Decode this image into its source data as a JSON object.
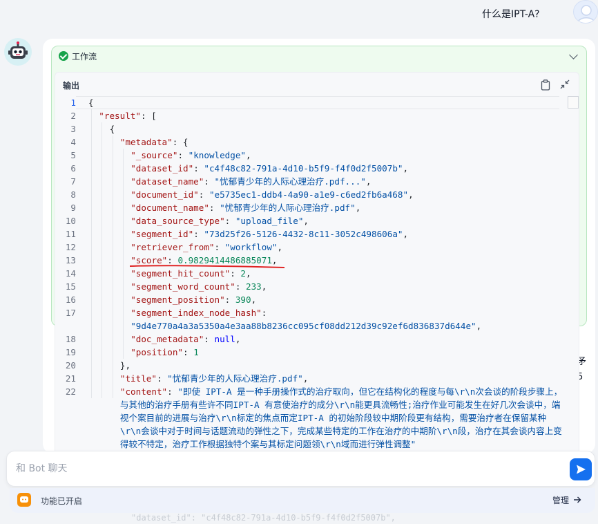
{
  "chat": {
    "user_message": "什么是IPT-A?",
    "input_placeholder": "和 Bot 聊天"
  },
  "workflow": {
    "title": "工作流",
    "status": "success"
  },
  "output": {
    "title": "输出",
    "lines": [
      {
        "n": "1",
        "indent": 0,
        "parts": [
          [
            "p",
            "{"
          ]
        ]
      },
      {
        "n": "2",
        "indent": 1,
        "parts": [
          [
            "k",
            "\"result\""
          ],
          [
            "p",
            ": ["
          ]
        ]
      },
      {
        "n": "3",
        "indent": 2,
        "parts": [
          [
            "p",
            "{"
          ]
        ]
      },
      {
        "n": "4",
        "indent": 3,
        "parts": [
          [
            "k",
            "\"metadata\""
          ],
          [
            "p",
            ": {"
          ]
        ]
      },
      {
        "n": "5",
        "indent": 4,
        "parts": [
          [
            "k",
            "\"_source\""
          ],
          [
            "p",
            ": "
          ],
          [
            "s",
            "\"knowledge\""
          ],
          [
            "p",
            ","
          ]
        ]
      },
      {
        "n": "6",
        "indent": 4,
        "parts": [
          [
            "k",
            "\"dataset_id\""
          ],
          [
            "p",
            ": "
          ],
          [
            "s",
            "\"c4f48c82-791a-4d10-b5f9-f4f0d2f5007b\""
          ],
          [
            "p",
            ","
          ]
        ]
      },
      {
        "n": "7",
        "indent": 4,
        "parts": [
          [
            "k",
            "\"dataset_name\""
          ],
          [
            "p",
            ": "
          ],
          [
            "s",
            "\"忧郁青少年的人际心理治疗.pdf...\""
          ],
          [
            "p",
            ","
          ]
        ]
      },
      {
        "n": "8",
        "indent": 4,
        "parts": [
          [
            "k",
            "\"document_id\""
          ],
          [
            "p",
            ": "
          ],
          [
            "s",
            "\"e5735ec1-ddb4-4a90-a1e9-c6ed2fb6a468\""
          ],
          [
            "p",
            ","
          ]
        ]
      },
      {
        "n": "9",
        "indent": 4,
        "parts": [
          [
            "k",
            "\"document_name\""
          ],
          [
            "p",
            ": "
          ],
          [
            "s",
            "\"忧郁青少年的人际心理治疗.pdf\""
          ],
          [
            "p",
            ","
          ]
        ]
      },
      {
        "n": "10",
        "indent": 4,
        "parts": [
          [
            "k",
            "\"data_source_type\""
          ],
          [
            "p",
            ": "
          ],
          [
            "s",
            "\"upload_file\""
          ],
          [
            "p",
            ","
          ]
        ]
      },
      {
        "n": "11",
        "indent": 4,
        "parts": [
          [
            "k",
            "\"segment_id\""
          ],
          [
            "p",
            ": "
          ],
          [
            "s",
            "\"73d25f26-5126-4432-8c11-3052c498606a\""
          ],
          [
            "p",
            ","
          ]
        ]
      },
      {
        "n": "12",
        "indent": 4,
        "parts": [
          [
            "k",
            "\"retriever_from\""
          ],
          [
            "p",
            ": "
          ],
          [
            "s",
            "\"workflow\""
          ],
          [
            "p",
            ","
          ]
        ]
      },
      {
        "n": "13",
        "indent": 4,
        "parts": [
          [
            "k",
            "\"score\""
          ],
          [
            "p",
            ": "
          ],
          [
            "n",
            "0.9829414486885071"
          ],
          [
            "p",
            ","
          ]
        ]
      },
      {
        "n": "14",
        "indent": 4,
        "parts": [
          [
            "k",
            "\"segment_hit_count\""
          ],
          [
            "p",
            ": "
          ],
          [
            "n",
            "2"
          ],
          [
            "p",
            ","
          ]
        ]
      },
      {
        "n": "15",
        "indent": 4,
        "parts": [
          [
            "k",
            "\"segment_word_count\""
          ],
          [
            "p",
            ": "
          ],
          [
            "n",
            "233"
          ],
          [
            "p",
            ","
          ]
        ]
      },
      {
        "n": "16",
        "indent": 4,
        "parts": [
          [
            "k",
            "\"segment_position\""
          ],
          [
            "p",
            ": "
          ],
          [
            "n",
            "390"
          ],
          [
            "p",
            ","
          ]
        ]
      },
      {
        "n": "17",
        "indent": 4,
        "parts": [
          [
            "k",
            "\"segment_index_node_hash\""
          ],
          [
            "p",
            ":"
          ]
        ]
      },
      {
        "n": "",
        "indent": 4,
        "parts": [
          [
            "s",
            "\"9d4e770a4a3a5350a4e3aa88b8236cc095cf08dd212d39c92ef6d836837d644e\""
          ],
          [
            "p",
            ","
          ]
        ]
      },
      {
        "n": "18",
        "indent": 4,
        "parts": [
          [
            "k",
            "\"doc_metadata\""
          ],
          [
            "p",
            ": "
          ],
          [
            "b",
            "null"
          ],
          [
            "p",
            ","
          ]
        ]
      },
      {
        "n": "19",
        "indent": 4,
        "parts": [
          [
            "k",
            "\"position\""
          ],
          [
            "p",
            ": "
          ],
          [
            "n",
            "1"
          ]
        ]
      },
      {
        "n": "20",
        "indent": 3,
        "parts": [
          [
            "p",
            "},"
          ]
        ]
      },
      {
        "n": "21",
        "indent": 3,
        "parts": [
          [
            "k",
            "\"title\""
          ],
          [
            "p",
            ": "
          ],
          [
            "s",
            "\"忧郁青少年的人际心理治疗.pdf\""
          ],
          [
            "p",
            ","
          ]
        ]
      },
      {
        "n": "22",
        "indent": 3,
        "wrap": true,
        "parts": [
          [
            "k",
            "\"content\""
          ],
          [
            "p",
            ": "
          ],
          [
            "s",
            "\"即使 IPT-A 是一种手册操作式的治疗取向，但它在结构化的程度与每\\r\\n次会谈的阶段步骤上，与其他的治疗手册有些许不同IPT-A 有意使治疗的成分\\r\\n能更具流畅性;治疗作业可能发生在好几次会谈中，端视个案目前的进展与治疗\\r\\n标定的焦点而定IPT-A 的初始阶段较中期阶段更有结构，需要治疗者在保留某种\\r\\n会谈中对于时间与话题流动的弹性之下，完成某些特定的工作在治疗的中期阶\\r\\n段，治疗在其会谈内容上变得较不特定，治疗工作根据独特个案与其标定问题领\\r\\n域而进行弹性调整\""
          ]
        ]
      }
    ]
  },
  "background": {
    "partial_char_1": "矛",
    "partial_char_2": "5",
    "hidden_line_fragment": "\"dataset_id\": \"c4f48c82-791a-4d10-b5f9-f4f0d2f5007b\","
  },
  "features": {
    "enabled_text": "功能已开启",
    "manage_label": "管理"
  },
  "colors": {
    "accent": "#1570ef",
    "success": "#16a34a",
    "feature_icon": "#f79009",
    "json_key": "#a31515",
    "json_string": "#0451a5",
    "json_number": "#098658",
    "underline": "#e02424"
  }
}
